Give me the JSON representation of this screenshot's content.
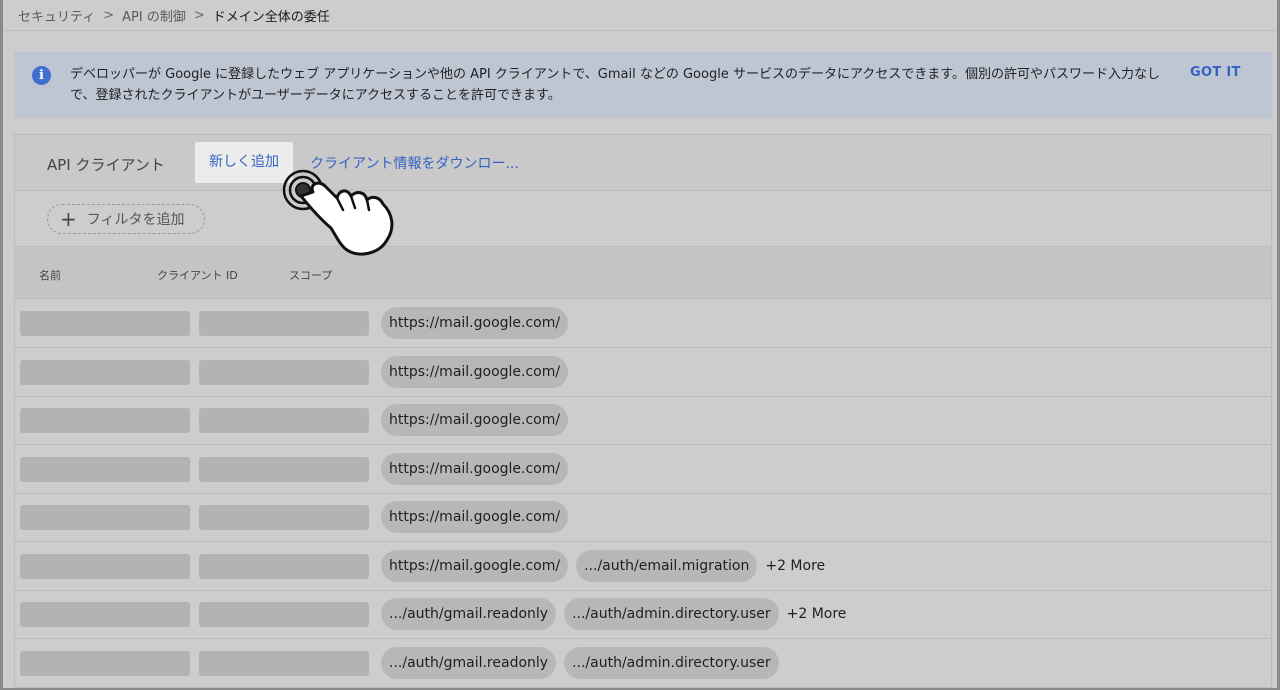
{
  "breadcrumb": {
    "items": [
      "セキュリティ",
      "API の制御",
      "ドメイン全体の委任"
    ],
    "separator": ">"
  },
  "banner": {
    "text": "デベロッパーが Google に登録したウェブ アプリケーションや他の API クライアントで、Gmail などの Google サービスのデータにアクセスできます。個別の許可やパスワード入力なしで、登録されたクライアントがユーザーデータにアクセスすることを許可できます。",
    "action": "GOT IT",
    "icon": "info-icon"
  },
  "toolbar": {
    "title": "API クライアント",
    "add_label": "新しく追加",
    "download_label": "クライアント情報をダウンロー..."
  },
  "filter": {
    "label": "フィルタを追加"
  },
  "columns": {
    "name": "名前",
    "client_id": "クライアント ID",
    "scope": "スコープ"
  },
  "rows": [
    {
      "scopes": [
        "https://mail.google.com/"
      ],
      "more": ""
    },
    {
      "scopes": [
        "https://mail.google.com/"
      ],
      "more": ""
    },
    {
      "scopes": [
        "https://mail.google.com/"
      ],
      "more": ""
    },
    {
      "scopes": [
        "https://mail.google.com/"
      ],
      "more": ""
    },
    {
      "scopes": [
        "https://mail.google.com/"
      ],
      "more": ""
    },
    {
      "scopes": [
        "https://mail.google.com/",
        ".../auth/email.migration"
      ],
      "more": "+2 More"
    },
    {
      "scopes": [
        ".../auth/gmail.readonly",
        ".../auth/admin.directory.user"
      ],
      "more": "+2 More"
    },
    {
      "scopes": [
        ".../auth/gmail.readonly",
        ".../auth/admin.directory.user"
      ],
      "more": ""
    }
  ],
  "colors": {
    "accent": "#3563c4",
    "overlay_bg": "#cdcdcd",
    "highlight": "#ececec"
  }
}
